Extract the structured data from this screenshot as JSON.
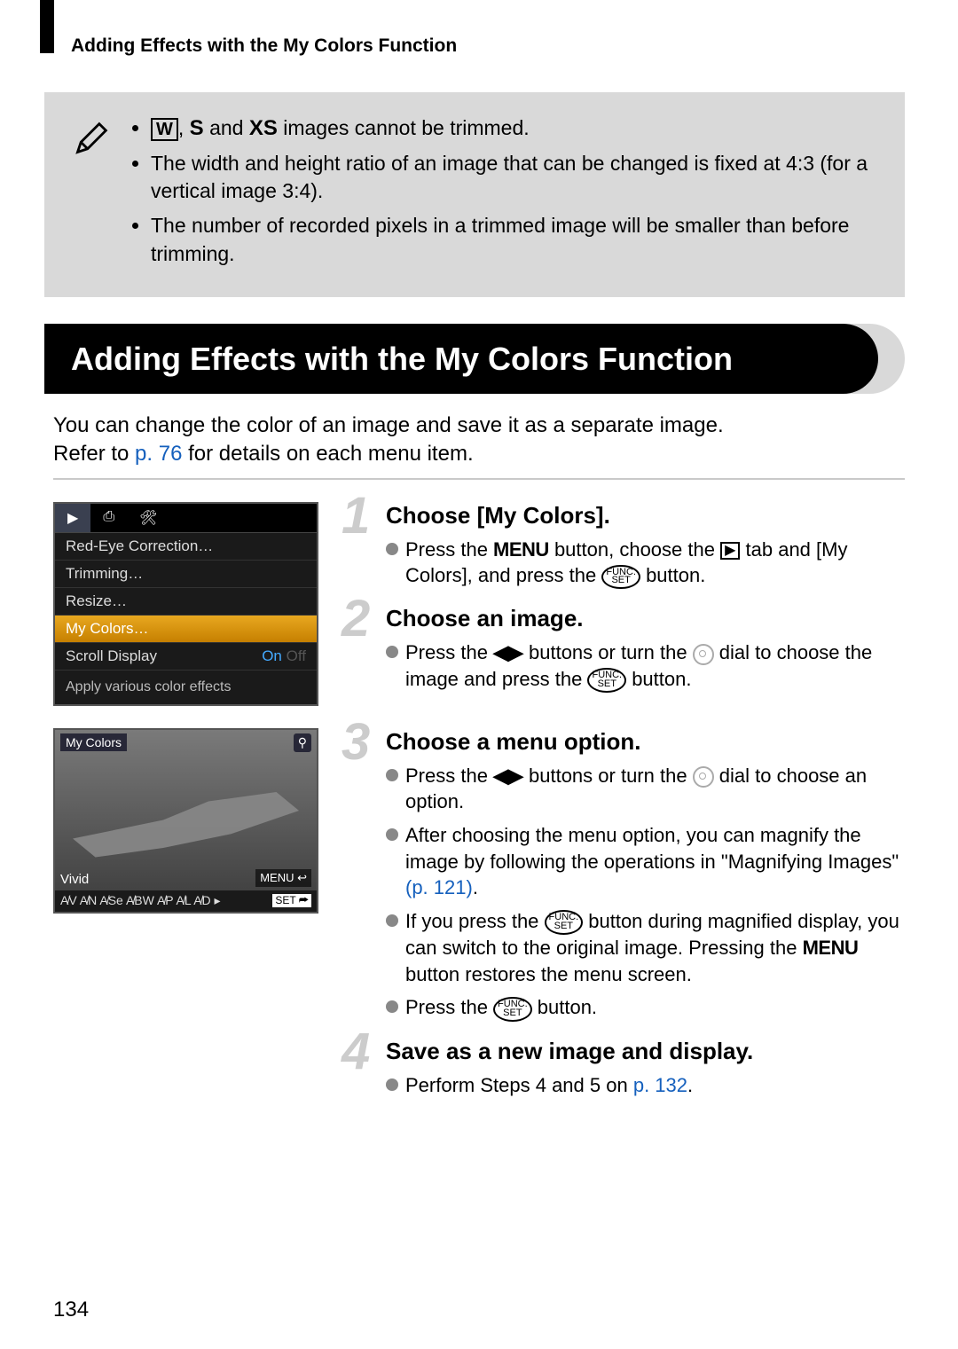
{
  "running_header": "Adding Effects with the My Colors Function",
  "note": {
    "icon_w": "W",
    "icon_s": "S",
    "icon_xs": "XS",
    "bullet1_mid": ", ",
    "bullet1_text": " images cannot be trimmed.",
    "bullet1_and": " and ",
    "bullet2": "The width and height ratio of an image that can be changed is fixed at 4:3 (for a vertical image 3:4).",
    "bullet3": "The number of recorded pixels in a trimmed image will be smaller than before trimming."
  },
  "section_title": "Adding Effects with the My Colors Function",
  "intro": {
    "line1": "You can change the color of an image and save it as a separate image.",
    "line2_a": "Refer to ",
    "line2_link": "p. 76",
    "line2_b": " for details on each menu item."
  },
  "menu": {
    "tab_play": "▶",
    "tab_print": "⎙",
    "tab_tools": "🛠",
    "rows": {
      "redeye": "Red-Eye Correction…",
      "trimming": "Trimming…",
      "resize": "Resize…",
      "mycolors": "My Colors…",
      "scroll_label": "Scroll Display",
      "scroll_on": "On",
      "scroll_off": "Off"
    },
    "footer": "Apply various color effects"
  },
  "preview": {
    "title": "My Colors",
    "mode": "Vivid",
    "menu_back": "MENU ↩",
    "strip": "A̸V  A̸N  A̸Se  A̸BW  A̸P  A̸L  A̸D  ▸",
    "set": "SET ⮫",
    "magnify": "⚲"
  },
  "steps": {
    "s1": {
      "num": "1",
      "title": "Choose [My Colors].",
      "body_a": "Press the ",
      "body_menu": "MENU",
      "body_b": " button, choose the ",
      "body_c": " tab and [My Colors], and press the ",
      "body_d": " button."
    },
    "s2": {
      "num": "2",
      "title": "Choose an image.",
      "body_a": "Press the ",
      "lr": "◀▶",
      "body_b": " buttons or turn the ",
      "body_c": " dial to choose the image and press the ",
      "body_d": " button."
    },
    "s3": {
      "num": "3",
      "title": "Choose a menu option.",
      "l1a": "Press the ",
      "l1_lr": "◀▶",
      "l1b": " buttons or turn the ",
      "l1c": " dial to choose an option.",
      "l2a": "After choosing the menu option, you can magnify the image by following the operations in \"Magnifying Images\" ",
      "l2link": "(p. 121)",
      "l2b": ".",
      "l3a": "If you press the ",
      "l3b": " button during magnified display, you can switch to the original image. Pressing the ",
      "l3menu": "MENU",
      "l3c": " button restores the menu screen.",
      "l4a": "Press the ",
      "l4b": " button."
    },
    "s4": {
      "num": "4",
      "title": "Save as a new image and display.",
      "body_a": "Perform Steps 4 and 5 on ",
      "body_link": "p. 132",
      "body_b": "."
    }
  },
  "funcset": {
    "top": "FUNC.",
    "bot": "SET"
  },
  "page_number": "134"
}
